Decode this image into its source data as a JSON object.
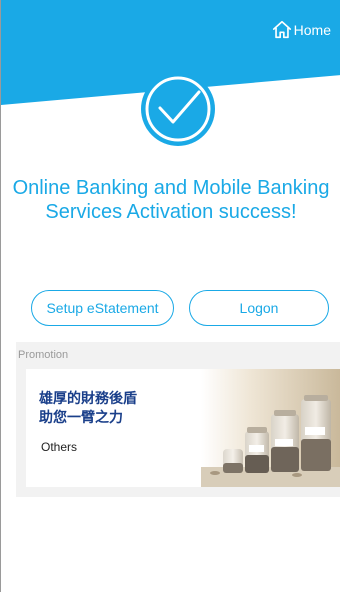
{
  "header": {
    "home_label": "Home",
    "brand_color": "#1aa9e6"
  },
  "status": {
    "icon": "check-circle-icon",
    "message": "Online Banking and Mobile Banking Services Activation success!"
  },
  "actions": {
    "setup_estatement_label": "Setup eStatement",
    "logon_label": "Logon"
  },
  "promotion": {
    "section_label": "Promotion",
    "card": {
      "headline_line1": "雄厚的財務後盾",
      "headline_line2": "助您一臂之力",
      "category": "Others",
      "image": "coin-jars-image"
    }
  }
}
